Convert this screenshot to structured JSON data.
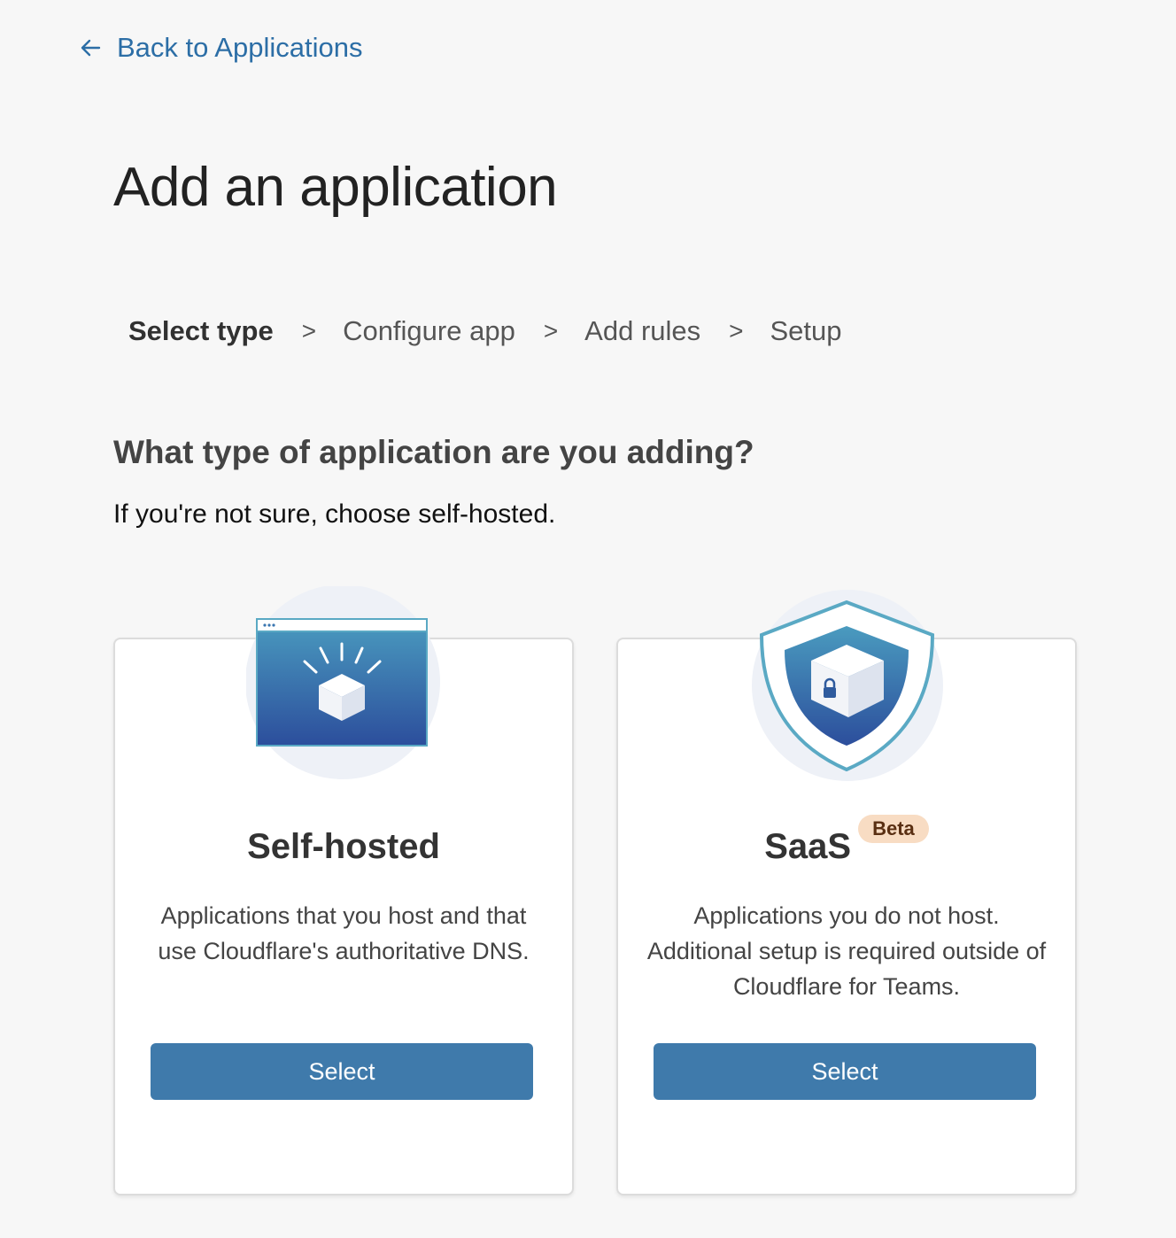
{
  "nav": {
    "back_label": "Back to Applications",
    "back_icon": "arrow-left-icon"
  },
  "page": {
    "title": "Add an application"
  },
  "steps": [
    {
      "label": "Select type",
      "active": true
    },
    {
      "label": "Configure app",
      "active": false
    },
    {
      "label": "Add rules",
      "active": false
    },
    {
      "label": "Setup",
      "active": false
    }
  ],
  "step_separator": ">",
  "question": "What type of application are you adding?",
  "hint": "If you're not sure, choose self-hosted.",
  "cards": {
    "self_hosted": {
      "icon": "browser-window-box-icon",
      "title": "Self-hosted",
      "description": "Applications that you host and that use Cloudflare's authoritative DNS.",
      "button_label": "Select"
    },
    "saas": {
      "icon": "shield-lock-box-icon",
      "title": "SaaS",
      "badge": "Beta",
      "description": "Applications you do not host. Additional setup is required outside of Cloudflare for Teams.",
      "button_label": "Select"
    }
  },
  "colors": {
    "link": "#2c6ea6",
    "button": "#3f7aab",
    "badge_bg": "#f8dcc3",
    "badge_text": "#5a2f12",
    "background": "#f7f7f7"
  }
}
